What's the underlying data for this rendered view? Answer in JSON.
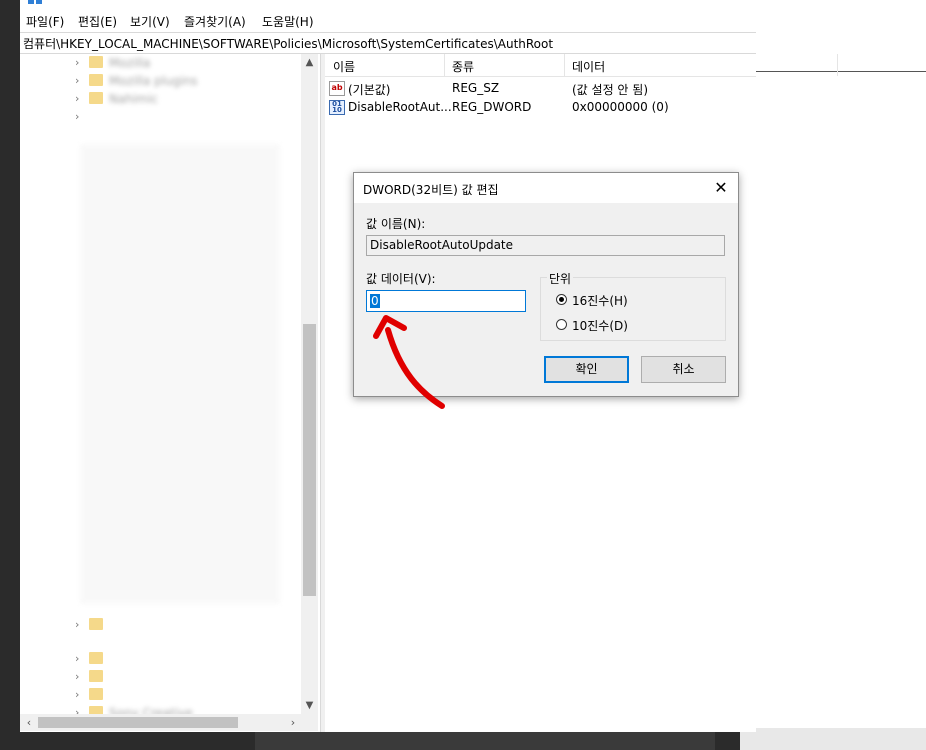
{
  "menu": {
    "file": "파일(F)",
    "edit": "편집(E)",
    "view": "보기(V)",
    "favorites": "즐겨찾기(A)",
    "help": "도움말(H)"
  },
  "address": {
    "path": "컴퓨터\\HKEY_LOCAL_MACHINE\\SOFTWARE\\Policies\\Microsoft\\SystemCertificates\\AuthRoot"
  },
  "tree": {
    "items": [
      {
        "label": "Mozilla"
      },
      {
        "label": "Mozilla plugins"
      },
      {
        "label": "Nahimic"
      },
      {
        "label": "Sony Creative"
      }
    ]
  },
  "list": {
    "columns": [
      "이름",
      "종류",
      "데이터"
    ],
    "rows": [
      {
        "icon": "string-value-icon",
        "name": "(기본값)",
        "type": "REG_SZ",
        "data": "(값 설정 안 됨)"
      },
      {
        "icon": "dword-value-icon",
        "name": "DisableRootAut...",
        "type": "REG_DWORD",
        "data": "0x00000000 (0)"
      }
    ]
  },
  "dialog": {
    "title": "DWORD(32비트) 값 편집",
    "name_label": "값 이름(N):",
    "name_value": "DisableRootAutoUpdate",
    "data_label": "값 데이터(V):",
    "data_value": "0",
    "base_group": "단위",
    "base_hex": "16진수(H)",
    "base_dec": "10진수(D)",
    "base_selected": "hex",
    "ok": "확인",
    "cancel": "취소"
  },
  "annotation": {
    "arrow_color": "#e00000"
  },
  "colors": {
    "accent": "#0078d7",
    "folder": "#f5d98a"
  }
}
